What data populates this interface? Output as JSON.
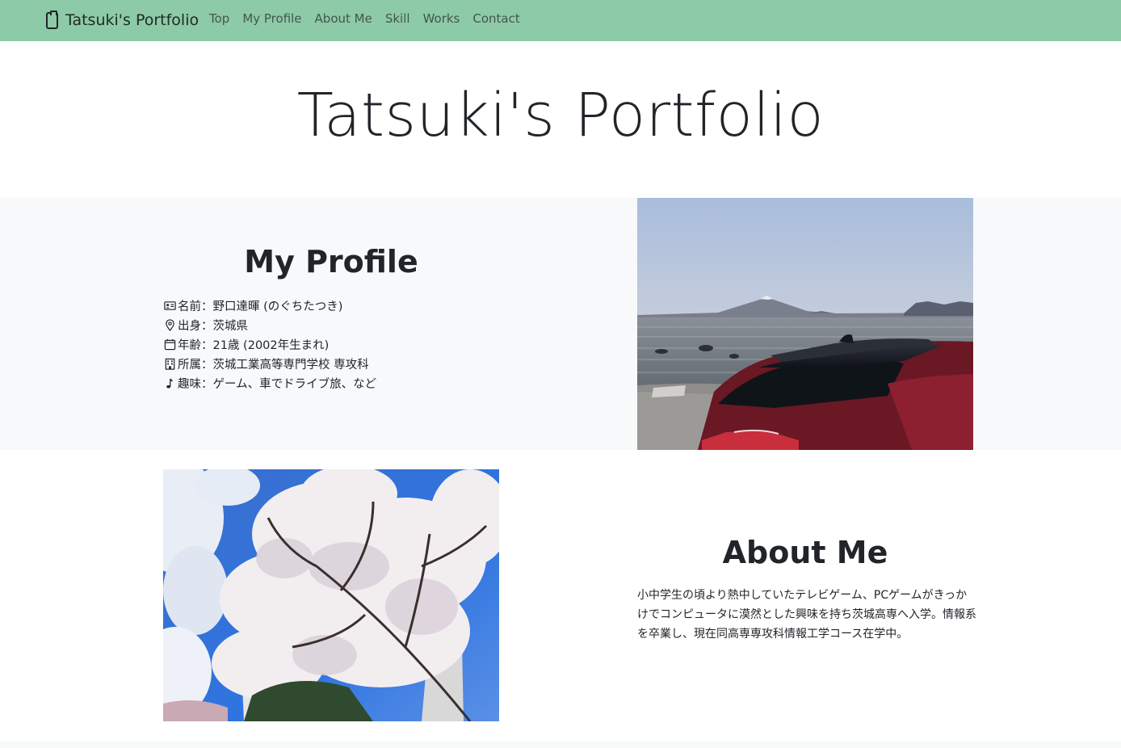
{
  "navbar": {
    "brand_icon": "clipboard-icon",
    "brand_text": "Tatsuki's Portfolio",
    "links": [
      "Top",
      "My Profile",
      "About Me",
      "Skill",
      "Works",
      "Contact"
    ],
    "bg_color": "#8dcaa8"
  },
  "hero": {
    "title": "Tatsuki's Portfolio"
  },
  "profile": {
    "heading": "My Profile",
    "items": [
      {
        "icon": "id-card-icon",
        "text": "名前：野口達暉 (のぐちたつき)"
      },
      {
        "icon": "location-pin-icon",
        "text": "出身：茨城県"
      },
      {
        "icon": "calendar-icon",
        "text": "年齢：21歳 (2002年生まれ)"
      },
      {
        "icon": "building-icon",
        "text": "所属：茨城工業高等専門学校 専攻科"
      },
      {
        "icon": "music-note-icon",
        "text": "趣味：ゲーム、車でドライブ旅、など"
      }
    ],
    "photo": "car-by-sea-with-mount-fuji-photo"
  },
  "about": {
    "heading": "About Me",
    "text": "小中学生の頃より熱中していたテレビゲーム、PCゲームがきっかけでコンピュータに漠然とした興味を持ち茨城高専へ入学。情報系を卒業し、現在同高専専攻科情報工学コース在学中。",
    "photo": "cherry-blossom-tree-photo"
  }
}
